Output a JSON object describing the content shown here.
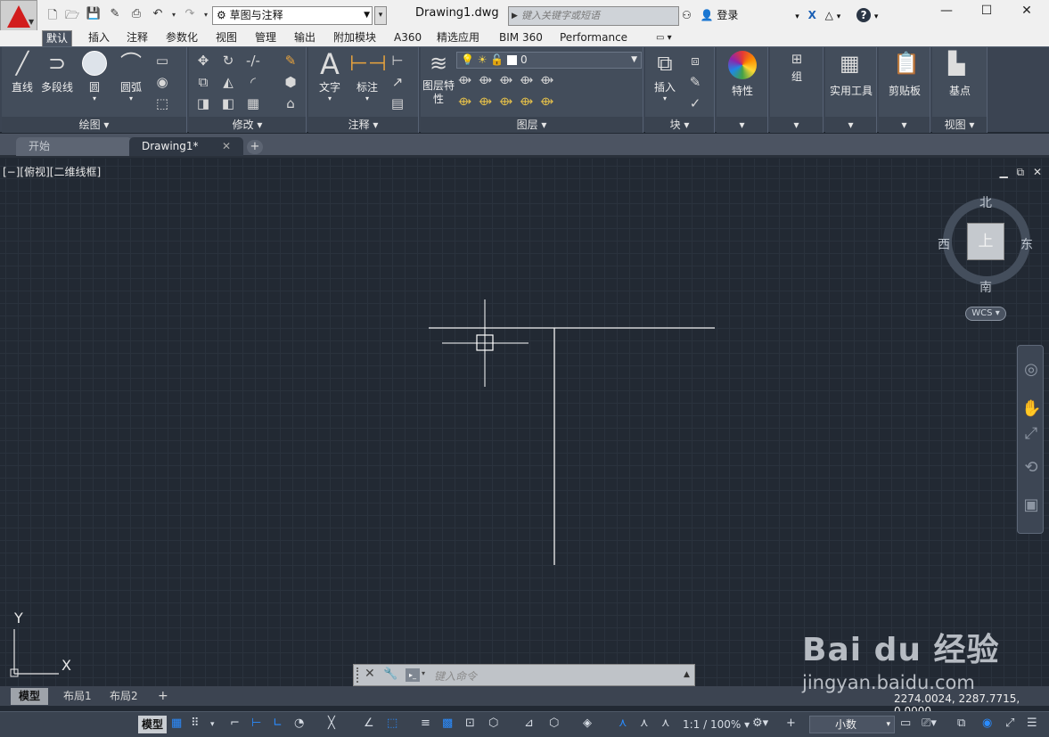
{
  "titlebar": {
    "workspace": "草图与注释",
    "doc_title": "Drawing1.dwg",
    "search_placeholder": "键入关键字或短语",
    "login": "登录",
    "window_controls": [
      "minimize-icon",
      "restore-icon",
      "close-icon"
    ]
  },
  "ribbon_tabs": [
    "默认",
    "插入",
    "注释",
    "参数化",
    "视图",
    "管理",
    "输出",
    "附加模块",
    "A360",
    "精选应用",
    "BIM 360",
    "Performance"
  ],
  "ribbon": {
    "draw": {
      "title": "绘图 ▾",
      "line": "直线",
      "polyline": "多段线",
      "circle": "圆",
      "arc": "圆弧"
    },
    "modify": {
      "title": "修改 ▾"
    },
    "annotation": {
      "title": "注释 ▾",
      "text": "文字",
      "dimension": "标注"
    },
    "layers": {
      "title": "图层 ▾",
      "layer_props": "图层特性",
      "current_layer": "0"
    },
    "block": {
      "title": "块 ▾",
      "insert": "插入"
    },
    "properties": {
      "label": "特性"
    },
    "groups": {
      "label": "组"
    },
    "utilities": {
      "label": "实用工具"
    },
    "clipboard": {
      "label": "剪贴板"
    },
    "view": {
      "label": "基点",
      "title": "视图 ▾"
    }
  },
  "file_tabs": {
    "start": "开始",
    "drawing": "Drawing1*"
  },
  "viewport": {
    "label": "[−][俯视][二维线框]",
    "viewcube": {
      "north": "北",
      "south": "南",
      "east": "东",
      "west": "西",
      "top": "上",
      "wcs": "WCS"
    },
    "ucs": {
      "x": "X",
      "y": "Y"
    }
  },
  "command_line": {
    "placeholder": "键入命令"
  },
  "layout_tabs": [
    "模型",
    "布局1",
    "布局2"
  ],
  "coordinates": "2274.0024, 2287.7715, 0.0000",
  "status": {
    "model": "模型",
    "scale": "1:1 / 100%",
    "units": "小数"
  },
  "watermark": {
    "brand": "Bai du 经验",
    "url": "jingyan.baidu.com"
  }
}
